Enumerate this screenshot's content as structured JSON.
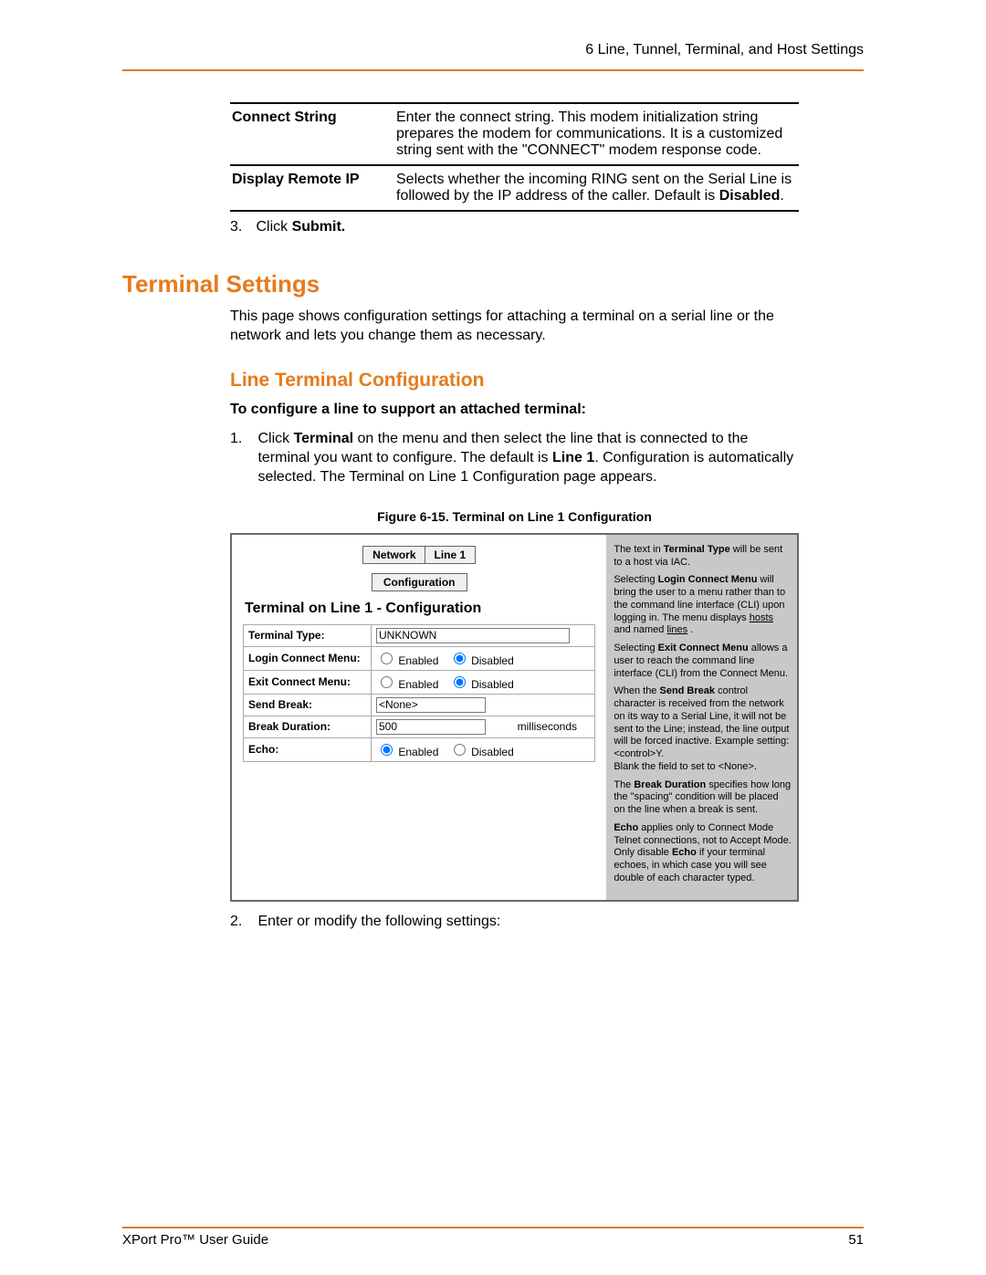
{
  "header": {
    "running": "6 Line, Tunnel, Terminal, and Host Settings"
  },
  "params": [
    {
      "label": "Connect String",
      "desc": "Enter the connect string. This modem initialization string prepares the modem for communications. It is a customized string sent with the \"CONNECT\" modem response code."
    },
    {
      "label": "Display Remote IP",
      "desc": "Selects whether the incoming RING sent on the Serial Line is followed by the IP address of the caller. Default is ",
      "trail_bold": "Disabled",
      "trail_after": "."
    }
  ],
  "step3": {
    "num": "3.",
    "pre": "Click ",
    "bold": "Submit."
  },
  "h1": "Terminal Settings",
  "intro": "This page shows configuration settings for attaching a terminal on a serial line or the network and lets you change them as necessary.",
  "h2": "Line Terminal Configuration",
  "lead_bold": "To configure a line to support an attached terminal:",
  "ol1": {
    "num": "1.",
    "p1a": "Click ",
    "p1b": "Terminal",
    "p1c": " on the menu and then select the line that is connected to the terminal you want to configure. The default is ",
    "p1d": "Line 1",
    "p1e": ". Configuration is automatically selected. The Terminal on Line 1 Configuration page appears."
  },
  "fig_caption": "Figure 6-15. Terminal on Line 1 Configuration",
  "shot": {
    "tabs": {
      "network": "Network",
      "line1": "Line 1",
      "config": "Configuration"
    },
    "title": "Terminal on Line 1 - Configuration",
    "rows": {
      "terminal_type_label": "Terminal Type:",
      "terminal_type_value": "UNKNOWN",
      "login_label": "Login Connect Menu:",
      "exit_label": "Exit Connect Menu:",
      "send_break_label": "Send Break:",
      "send_break_value": "<None>",
      "break_dur_label": "Break Duration:",
      "break_dur_value": "500",
      "break_dur_unit": "milliseconds",
      "echo_label": "Echo:",
      "enabled": "Enabled",
      "disabled": "Disabled"
    },
    "help": {
      "p1a": "The text in ",
      "p1b": "Terminal Type",
      "p1c": " will be sent to a host via IAC.",
      "p2a": "Selecting ",
      "p2b": "Login Connect Menu",
      "p2c": " will bring the user to a menu rather than to the command line interface (CLI) upon logging in. The menu displays ",
      "p2d": "hosts",
      "p2e": " and named ",
      "p2f": "lines",
      "p2g": " .",
      "p3a": "Selecting ",
      "p3b": "Exit Connect Menu",
      "p3c": " allows a user to reach the command line interface (CLI) from the Connect Menu.",
      "p4a": "When the ",
      "p4b": "Send Break",
      "p4c": " control character is received from the network on its way to a Serial Line, it will not be sent to the Line; instead, the line output will be forced inactive. Example setting: <control>Y.",
      "p4d": "Blank the field to set to <None>.",
      "p5a": "The ",
      "p5b": "Break Duration",
      "p5c": " specifies how long the \"spacing\" condition will be placed on the line when a break is sent.",
      "p6a": "Echo",
      "p6b": " applies only to Connect Mode Telnet connections, not to Accept Mode. Only disable ",
      "p6c": "Echo",
      "p6d": " if your terminal echoes, in which case you will see double of each character typed."
    }
  },
  "ol2": {
    "num": "2.",
    "text": "Enter or modify the following settings:"
  },
  "footer": {
    "left": "XPort Pro™ User Guide",
    "right": "51"
  }
}
